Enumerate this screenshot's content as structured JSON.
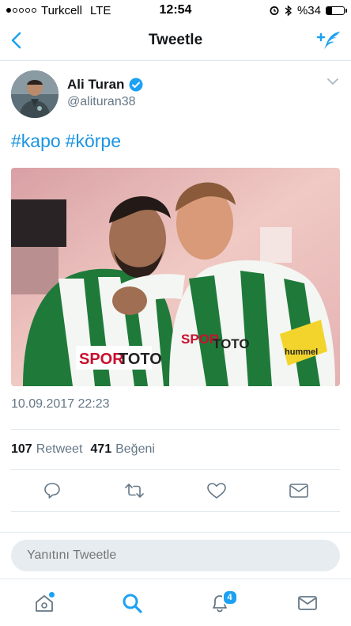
{
  "status_bar": {
    "carrier": "Turkcell",
    "network": "LTE",
    "time": "12:54",
    "battery": "%34",
    "battery_level": 0.34
  },
  "navbar": {
    "title": "Tweetle"
  },
  "tweet": {
    "author_name": "Ali Turan",
    "author_handle": "@alituran38",
    "hashtags": [
      "#kapo",
      "#körpe"
    ],
    "timestamp": "10.09.2017 22:23",
    "retweet_count": "107",
    "retweet_label": "Retweet",
    "like_count": "471",
    "like_label": "Beğeni"
  },
  "reply": {
    "placeholder": "Yanıtını Tweetle"
  },
  "tabbar": {
    "notification_badge": "4"
  },
  "colors": {
    "accent": "#1da1f2",
    "secondary_text": "#657786",
    "divider": "#e1e8ed"
  }
}
